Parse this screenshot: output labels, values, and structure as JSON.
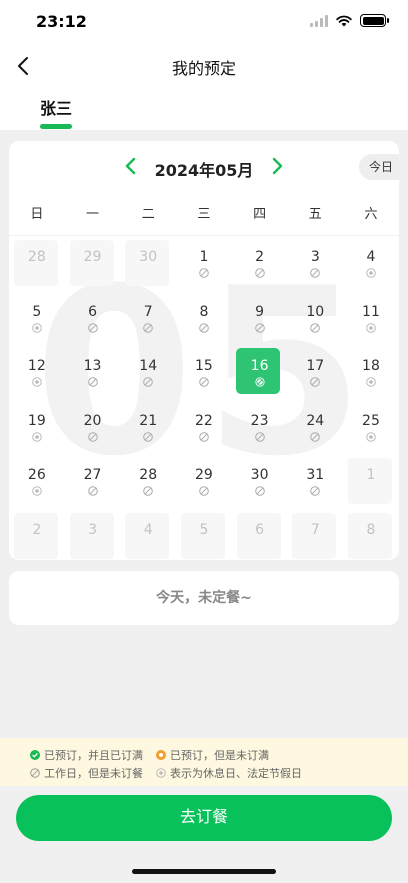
{
  "status_bar": {
    "time": "23:12"
  },
  "nav": {
    "title": "我的预定"
  },
  "tabs": [
    {
      "label": "张三"
    }
  ],
  "calendar": {
    "month_label": "2024年05月",
    "today_label": "今日",
    "watermark": "05",
    "weekdays": [
      "日",
      "一",
      "二",
      "三",
      "四",
      "五",
      "六"
    ],
    "days": [
      {
        "n": "28",
        "other": true,
        "status": ""
      },
      {
        "n": "29",
        "other": true,
        "status": ""
      },
      {
        "n": "30",
        "other": true,
        "status": ""
      },
      {
        "n": "1",
        "status": "workday"
      },
      {
        "n": "2",
        "status": "workday"
      },
      {
        "n": "3",
        "status": "workday"
      },
      {
        "n": "4",
        "status": "holiday"
      },
      {
        "n": "5",
        "status": "holiday"
      },
      {
        "n": "6",
        "status": "workday"
      },
      {
        "n": "7",
        "status": "workday"
      },
      {
        "n": "8",
        "status": "workday"
      },
      {
        "n": "9",
        "status": "workday"
      },
      {
        "n": "10",
        "status": "workday"
      },
      {
        "n": "11",
        "status": "holiday"
      },
      {
        "n": "12",
        "status": "holiday"
      },
      {
        "n": "13",
        "status": "workday"
      },
      {
        "n": "14",
        "status": "workday"
      },
      {
        "n": "15",
        "status": "workday"
      },
      {
        "n": "16",
        "status": "workday",
        "selected": true
      },
      {
        "n": "17",
        "status": "workday"
      },
      {
        "n": "18",
        "status": "holiday"
      },
      {
        "n": "19",
        "status": "holiday"
      },
      {
        "n": "20",
        "status": "workday"
      },
      {
        "n": "21",
        "status": "workday"
      },
      {
        "n": "22",
        "status": "workday"
      },
      {
        "n": "23",
        "status": "workday"
      },
      {
        "n": "24",
        "status": "workday"
      },
      {
        "n": "25",
        "status": "holiday"
      },
      {
        "n": "26",
        "status": "holiday"
      },
      {
        "n": "27",
        "status": "workday"
      },
      {
        "n": "28",
        "status": "workday"
      },
      {
        "n": "29",
        "status": "workday"
      },
      {
        "n": "30",
        "status": "workday"
      },
      {
        "n": "31",
        "status": "workday"
      },
      {
        "n": "1",
        "other": true,
        "status": ""
      },
      {
        "n": "2",
        "other": true,
        "status": ""
      },
      {
        "n": "3",
        "other": true,
        "status": ""
      },
      {
        "n": "4",
        "other": true,
        "status": ""
      },
      {
        "n": "5",
        "other": true,
        "status": ""
      },
      {
        "n": "6",
        "other": true,
        "status": ""
      },
      {
        "n": "7",
        "other": true,
        "status": ""
      },
      {
        "n": "8",
        "other": true,
        "status": ""
      }
    ]
  },
  "summary": {
    "text": "今天，未定餐~"
  },
  "legend": {
    "booked_full": "已预订，并且已订满",
    "booked_partial": "已预订，但是未订满",
    "workday_unbooked": "工作日，但是未订餐",
    "holiday": "表示为休息日、法定节假日"
  },
  "colors": {
    "accent": "#19b955",
    "selected_bg": "#2ec473",
    "partial": "#f0a030",
    "legend_bg": "#fdf8df"
  },
  "action": {
    "book_label": "去订餐"
  }
}
